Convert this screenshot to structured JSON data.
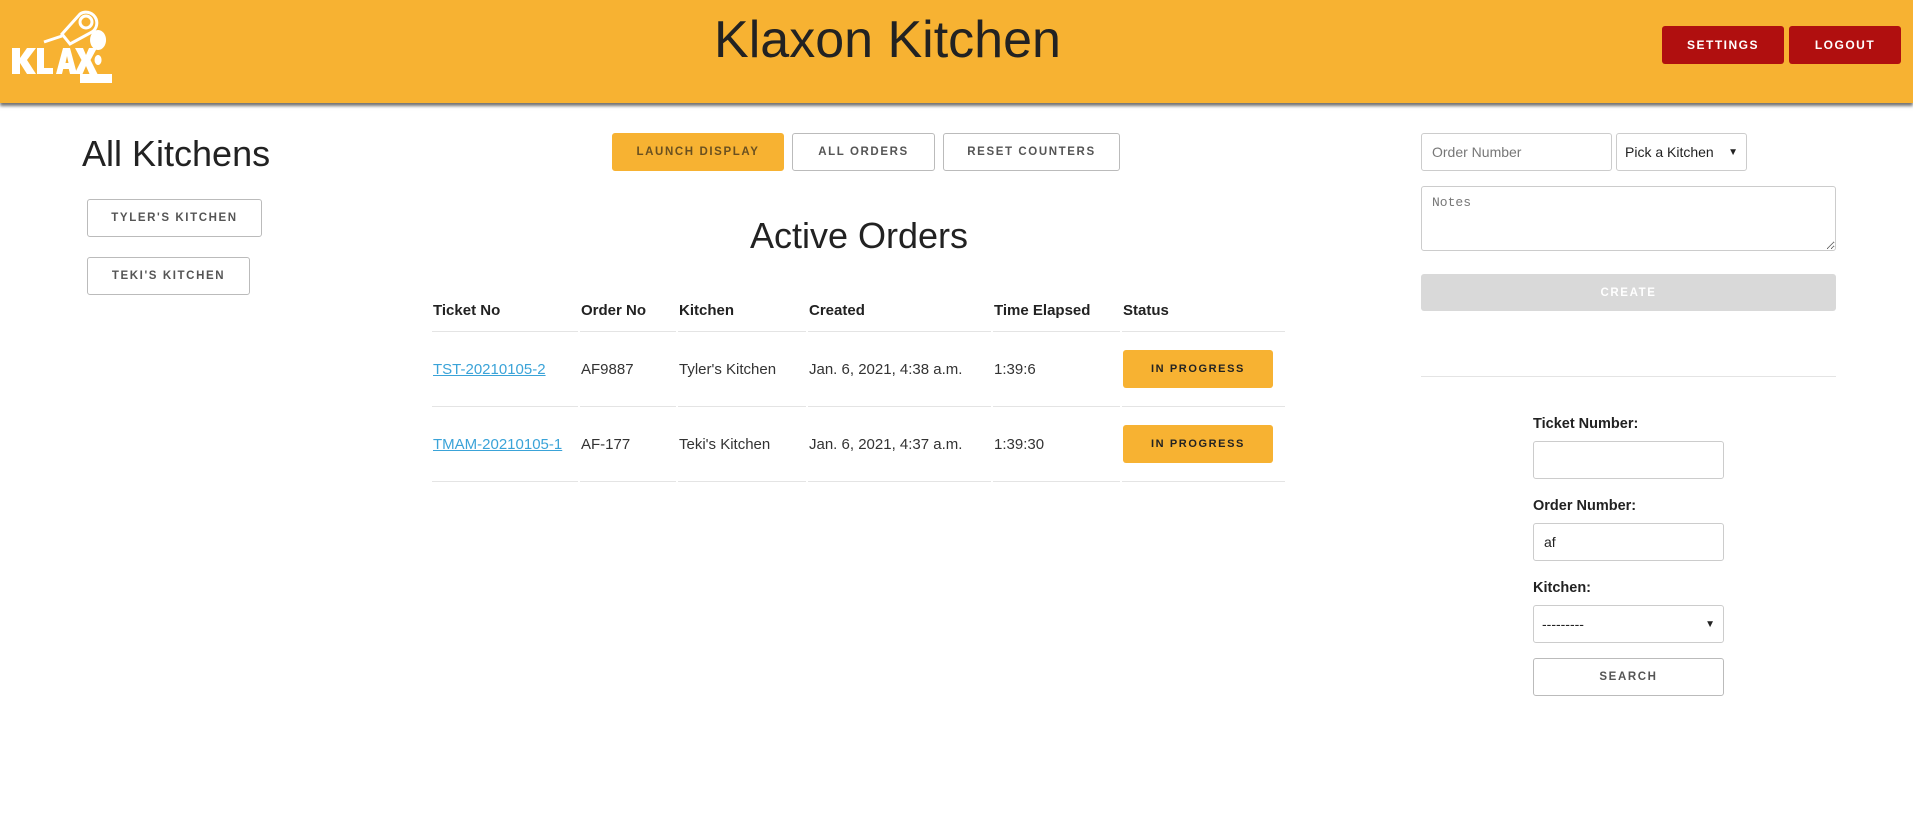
{
  "header": {
    "logo_text": "KLAXON KITCHEN",
    "title": "Klaxon Kitchen",
    "settings_label": "SETTINGS",
    "logout_label": "LOGOUT",
    "bg_color": "#f7b232",
    "button_color": "#b00f0f"
  },
  "sidebar": {
    "title": "All Kitchens",
    "kitchens": [
      "TYLER'S KITCHEN",
      "TEKI'S KITCHEN"
    ]
  },
  "toolbar": {
    "launch_display": "LAUNCH DISPLAY",
    "all_orders": "ALL ORDERS",
    "reset_counters": "RESET COUNTERS"
  },
  "main": {
    "title": "Active Orders",
    "columns": [
      "Ticket No",
      "Order No",
      "Kitchen",
      "Created",
      "Time Elapsed",
      "Status"
    ],
    "rows": [
      {
        "ticket": "TST-20210105-2",
        "order": "AF9887",
        "kitchen": "Tyler's Kitchen",
        "created": "Jan. 6, 2021, 4:38 a.m.",
        "elapsed": "1:39:6",
        "status": "IN PROGRESS"
      },
      {
        "ticket": "TMAM-20210105-1",
        "order": "AF-177",
        "kitchen": "Teki's Kitchen",
        "created": "Jan. 6, 2021, 4:37 a.m.",
        "elapsed": "1:39:30",
        "status": "IN PROGRESS"
      }
    ]
  },
  "create_form": {
    "order_placeholder": "Order Number",
    "kitchen_select": "Pick a Kitchen",
    "notes_placeholder": "Notes",
    "create_label": "CREATE"
  },
  "search_form": {
    "ticket_label": "Ticket Number:",
    "ticket_value": "",
    "order_label": "Order Number:",
    "order_value": "af",
    "kitchen_label": "Kitchen:",
    "kitchen_value": "---------",
    "search_label": "SEARCH"
  }
}
